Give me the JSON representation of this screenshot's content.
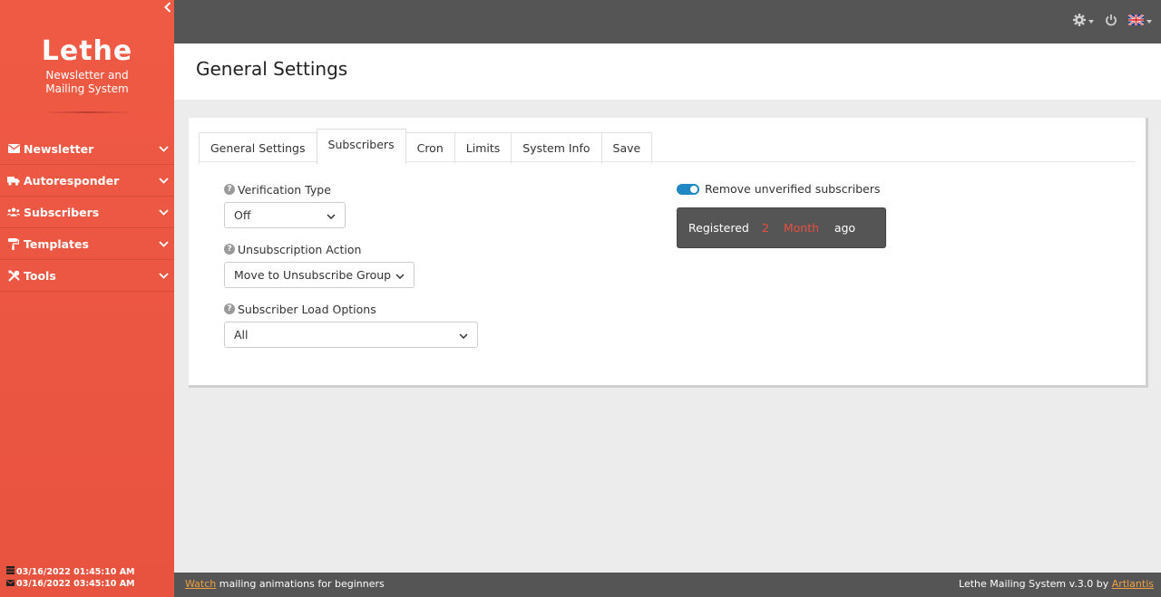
{
  "sidebar": {
    "brand_title": "Lethe",
    "brand_subtitle": "Newsletter and Mailing System",
    "items": [
      {
        "label": "Newsletter",
        "icon": "envelope-icon"
      },
      {
        "label": "Autoresponder",
        "icon": "truck-icon"
      },
      {
        "label": "Subscribers",
        "icon": "users-icon"
      },
      {
        "label": "Templates",
        "icon": "paint-roller-icon"
      },
      {
        "label": "Tools",
        "icon": "tools-icon"
      }
    ],
    "dates": [
      {
        "icon": "server-icon",
        "text": "03/16/2022 01:45:10 AM"
      },
      {
        "icon": "envelope-icon",
        "text": "03/16/2022 03:45:10 AM"
      }
    ]
  },
  "topbar": {
    "icons": [
      "gear-icon",
      "power-icon",
      "uk-flag-icon"
    ]
  },
  "page": {
    "title": "General Settings"
  },
  "tabs": [
    {
      "label": "General Settings",
      "active": false
    },
    {
      "label": "Subscribers",
      "active": true
    },
    {
      "label": "Cron",
      "active": false
    },
    {
      "label": "Limits",
      "active": false
    },
    {
      "label": "System Info",
      "active": false
    },
    {
      "label": "Save",
      "active": false
    }
  ],
  "form": {
    "verification_type": {
      "label": "Verification Type",
      "value": "Off"
    },
    "unsubscription_action": {
      "label": "Unsubscription Action",
      "value": "Move to Unsubscribe Group"
    },
    "subscriber_load_options": {
      "label": "Subscriber Load Options",
      "value": "All"
    },
    "remove_unverified": {
      "label": "Remove unverified subscribers",
      "enabled": true
    },
    "registered": {
      "prefix": "Registered",
      "number": "2",
      "unit": "Month",
      "suffix": "ago"
    }
  },
  "footer": {
    "watch_link": "Watch",
    "watch_text": " mailing animations for beginners",
    "version_text": "Lethe Mailing System v.3.0 by ",
    "author_link": "Artlantis"
  },
  "colors": {
    "sidebar": "#ea5440",
    "topbar": "#555555",
    "accent_red": "#e8503f",
    "toggle_blue": "#1f87c4",
    "link_orange": "#f0a040"
  }
}
